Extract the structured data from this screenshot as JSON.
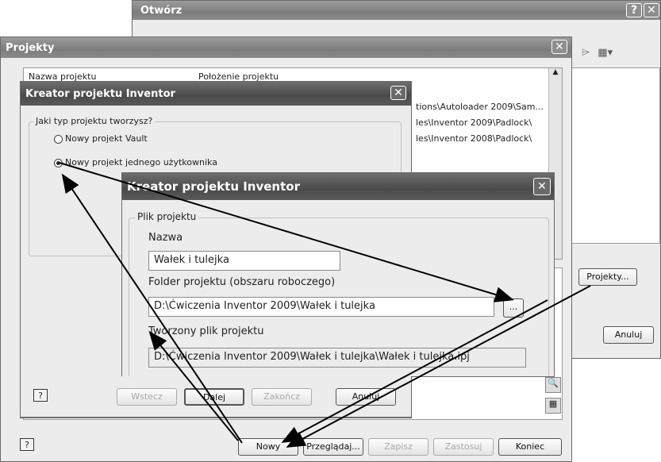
{
  "otworz": {
    "title": "Otwórz",
    "help": "?",
    "close": "✕",
    "projekty_button": "Projekty...",
    "anuluj_button": "Anuluj"
  },
  "projekty": {
    "title": "Projekty",
    "close": "✕",
    "columns": [
      "Nazwa projektu",
      "Położenie projektu"
    ],
    "locations": [
      "tions\\Autoloader 2009\\Sam...",
      "les\\Inventor 2009\\Padlock\\",
      "les\\Inventor 2008\\Padlock\\"
    ],
    "help": "?",
    "buttons": {
      "nowy": "Nowy",
      "przegladaj": "Przeglądaj...",
      "zapisz": "Zapisz",
      "zastosuj": "Zastosuj",
      "koniec": "Koniec"
    }
  },
  "kreator1": {
    "title": "Kreator projektu Inventor",
    "close": "✕",
    "group_label": "Jaki typ projektu tworzysz?",
    "option_vault": "Nowy projekt Vault",
    "option_single": "Nowy projekt jednego użytkownika",
    "selected": "option_single"
  },
  "kreator2": {
    "title": "Kreator projektu Inventor",
    "close": "✕",
    "group_label": "Plik projektu",
    "name_label": "Nazwa",
    "name_value": "Wałek i tulejka",
    "folder_label": "Folder projektu (obszaru roboczego)",
    "folder_value": "D:\\Ćwiczenia Inventor 2009\\Wałek i tulejka",
    "browse": "...",
    "file_label": "Tworzony plik projektu",
    "file_value": "D:\\Ćwiczenia Inventor 2009\\Wałek i tulejka\\Wałek i tulejka.ipj",
    "help": "?",
    "buttons": {
      "wstecz": "Wstecz",
      "dalej": "Dalej",
      "zakoncz": "Zakończ",
      "anuluj": "Anuluj"
    }
  },
  "colors": {
    "titlebar_dark": "#4a4a4a",
    "titlebar_grey": "#8a8a8a",
    "window_bg": "#ececec"
  }
}
